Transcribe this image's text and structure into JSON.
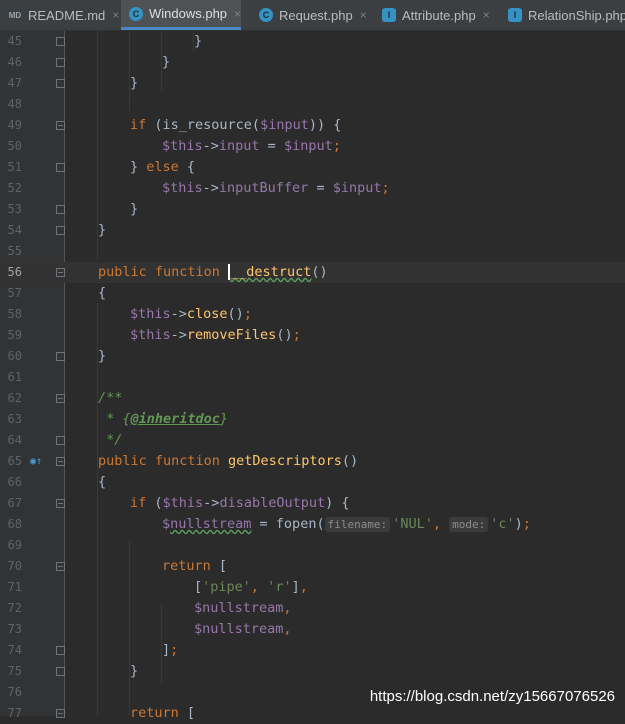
{
  "tabs": [
    {
      "label": "README.md",
      "icon": "md",
      "active": false
    },
    {
      "label": "Windows.php",
      "icon": "c",
      "active": true
    },
    {
      "label": "Request.php",
      "icon": "c",
      "active": false
    },
    {
      "label": "Attribute.php",
      "icon": "i",
      "active": false
    },
    {
      "label": "RelationShip.php",
      "icon": "i",
      "active": false
    }
  ],
  "tab_close_glyph": "×",
  "icon_letters": {
    "md": "MD",
    "c": "C",
    "i": "I"
  },
  "current_line": 56,
  "watermark": "https://blog.csdn.net/zy15667076526",
  "lines": [
    {
      "n": 45,
      "indent": 6,
      "fold": "end",
      "tokens": [
        [
          "p",
          "}"
        ]
      ]
    },
    {
      "n": 46,
      "indent": 5,
      "fold": "end",
      "tokens": [
        [
          "p",
          "}"
        ]
      ]
    },
    {
      "n": 47,
      "indent": 4,
      "fold": "end",
      "tokens": [
        [
          "p",
          "}"
        ]
      ]
    },
    {
      "n": 48,
      "indent": 0,
      "tokens": []
    },
    {
      "n": 49,
      "indent": 4,
      "fold": "start",
      "tokens": [
        [
          "kw",
          "if"
        ],
        [
          "p",
          " (is_resource("
        ],
        [
          "var",
          "$input"
        ],
        [
          "p",
          ")) {"
        ]
      ]
    },
    {
      "n": 50,
      "indent": 5,
      "tokens": [
        [
          "var",
          "$this"
        ],
        [
          "p",
          "->"
        ],
        [
          "var",
          "input"
        ],
        [
          "p",
          " = "
        ],
        [
          "var",
          "$input"
        ],
        [
          "kw",
          ";"
        ]
      ]
    },
    {
      "n": 51,
      "indent": 4,
      "fold": "mid",
      "tokens": [
        [
          "p",
          "} "
        ],
        [
          "kw",
          "else"
        ],
        [
          "p",
          " {"
        ]
      ]
    },
    {
      "n": 52,
      "indent": 5,
      "tokens": [
        [
          "var",
          "$this"
        ],
        [
          "p",
          "->"
        ],
        [
          "var",
          "inputBuffer"
        ],
        [
          "p",
          " = "
        ],
        [
          "var",
          "$input"
        ],
        [
          "kw",
          ";"
        ]
      ]
    },
    {
      "n": 53,
      "indent": 4,
      "fold": "end",
      "tokens": [
        [
          "p",
          "}"
        ]
      ]
    },
    {
      "n": 54,
      "indent": 3,
      "fold": "end",
      "tokens": [
        [
          "p",
          "}"
        ]
      ]
    },
    {
      "n": 55,
      "indent": 0,
      "tokens": []
    },
    {
      "n": 56,
      "indent": 3,
      "fold": "start",
      "tokens": [
        [
          "kw",
          "public function "
        ],
        [
          "caret",
          ""
        ],
        [
          "fnsq",
          "__destruct"
        ],
        [
          "p",
          "()"
        ]
      ]
    },
    {
      "n": 57,
      "indent": 3,
      "tokens": [
        [
          "p",
          "{"
        ]
      ]
    },
    {
      "n": 58,
      "indent": 4,
      "tokens": [
        [
          "var",
          "$this"
        ],
        [
          "p",
          "->"
        ],
        [
          "fn",
          "close"
        ],
        [
          "p",
          "()"
        ],
        [
          "kw",
          ";"
        ]
      ]
    },
    {
      "n": 59,
      "indent": 4,
      "tokens": [
        [
          "var",
          "$this"
        ],
        [
          "p",
          "->"
        ],
        [
          "fn",
          "removeFiles"
        ],
        [
          "p",
          "()"
        ],
        [
          "kw",
          ";"
        ]
      ]
    },
    {
      "n": 60,
      "indent": 3,
      "fold": "end",
      "tokens": [
        [
          "p",
          "}"
        ]
      ]
    },
    {
      "n": 61,
      "indent": 0,
      "tokens": []
    },
    {
      "n": 62,
      "indent": 3,
      "fold": "start",
      "tokens": [
        [
          "doc",
          "/**"
        ]
      ]
    },
    {
      "n": 63,
      "indent": 3,
      "tokens": [
        [
          "doc",
          " * {"
        ],
        [
          "doctag",
          "@inheritdoc"
        ],
        [
          "doc",
          "}"
        ]
      ]
    },
    {
      "n": 64,
      "indent": 3,
      "fold": "end",
      "tokens": [
        [
          "doc",
          " */"
        ]
      ]
    },
    {
      "n": 65,
      "indent": 3,
      "fold": "start",
      "mark": "override",
      "tokens": [
        [
          "kw",
          "public function "
        ],
        [
          "fn",
          "getDescriptors"
        ],
        [
          "p",
          "()"
        ]
      ]
    },
    {
      "n": 66,
      "indent": 3,
      "tokens": [
        [
          "p",
          "{"
        ]
      ]
    },
    {
      "n": 67,
      "indent": 4,
      "fold": "start",
      "tokens": [
        [
          "kw",
          "if"
        ],
        [
          "p",
          " ("
        ],
        [
          "var",
          "$this"
        ],
        [
          "p",
          "->"
        ],
        [
          "var",
          "disableOutput"
        ],
        [
          "p",
          ") {"
        ]
      ]
    },
    {
      "n": 68,
      "indent": 5,
      "tokens": [
        [
          "var",
          "$"
        ],
        [
          "varsq",
          "nullstream"
        ],
        [
          "p",
          " = fopen("
        ],
        [
          "hint",
          "filename:"
        ],
        [
          "str",
          "'NUL'"
        ],
        [
          "kw",
          ", "
        ],
        [
          "hint",
          "mode:"
        ],
        [
          "str",
          "'c'"
        ],
        [
          "p",
          ")"
        ],
        [
          "kw",
          ";"
        ]
      ]
    },
    {
      "n": 69,
      "indent": 0,
      "tokens": []
    },
    {
      "n": 70,
      "indent": 5,
      "fold": "start",
      "tokens": [
        [
          "kw",
          "return"
        ],
        [
          "p",
          " ["
        ]
      ]
    },
    {
      "n": 71,
      "indent": 6,
      "tokens": [
        [
          "p",
          "["
        ],
        [
          "str",
          "'pipe'"
        ],
        [
          "kw",
          ", "
        ],
        [
          "str",
          "'r'"
        ],
        [
          "p",
          "]"
        ],
        [
          "kw",
          ","
        ]
      ]
    },
    {
      "n": 72,
      "indent": 6,
      "tokens": [
        [
          "var",
          "$nullstream"
        ],
        [
          "kw",
          ","
        ]
      ]
    },
    {
      "n": 73,
      "indent": 6,
      "tokens": [
        [
          "var",
          "$nullstream"
        ],
        [
          "kw",
          ","
        ]
      ]
    },
    {
      "n": 74,
      "indent": 5,
      "fold": "end",
      "tokens": [
        [
          "p",
          "]"
        ],
        [
          "kw",
          ";"
        ]
      ]
    },
    {
      "n": 75,
      "indent": 4,
      "fold": "end",
      "tokens": [
        [
          "p",
          "}"
        ]
      ]
    },
    {
      "n": 76,
      "indent": 0,
      "tokens": []
    },
    {
      "n": 77,
      "indent": 4,
      "fold": "start",
      "tokens": [
        [
          "kw",
          "return"
        ],
        [
          "p",
          " ["
        ]
      ]
    }
  ]
}
